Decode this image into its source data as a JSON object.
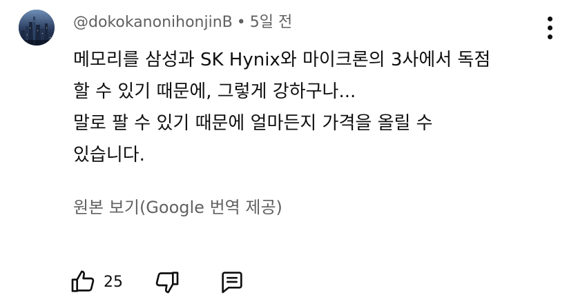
{
  "comment": {
    "author": "@dokokanonihonjinB",
    "separator": "•",
    "time": "5일 전",
    "lines": [
      "메모리를 삼성과 SK Hynix와 마이크론의 3사에서 독점",
      "할 수 있기 때문에, 그렇게 강하구나...",
      "말로 팔 수 있기 때문에 얼마든지 가격을 올릴 수",
      "있습니다."
    ],
    "translation_link": "원본 보기(Google 번역 제공)",
    "like_count": "25"
  },
  "icons": {
    "avatar": "city-night-avatar",
    "more": "vertical-dots-icon",
    "like": "thumbs-up-icon",
    "dislike": "thumbs-down-icon",
    "reply": "reply-comment-icon"
  }
}
